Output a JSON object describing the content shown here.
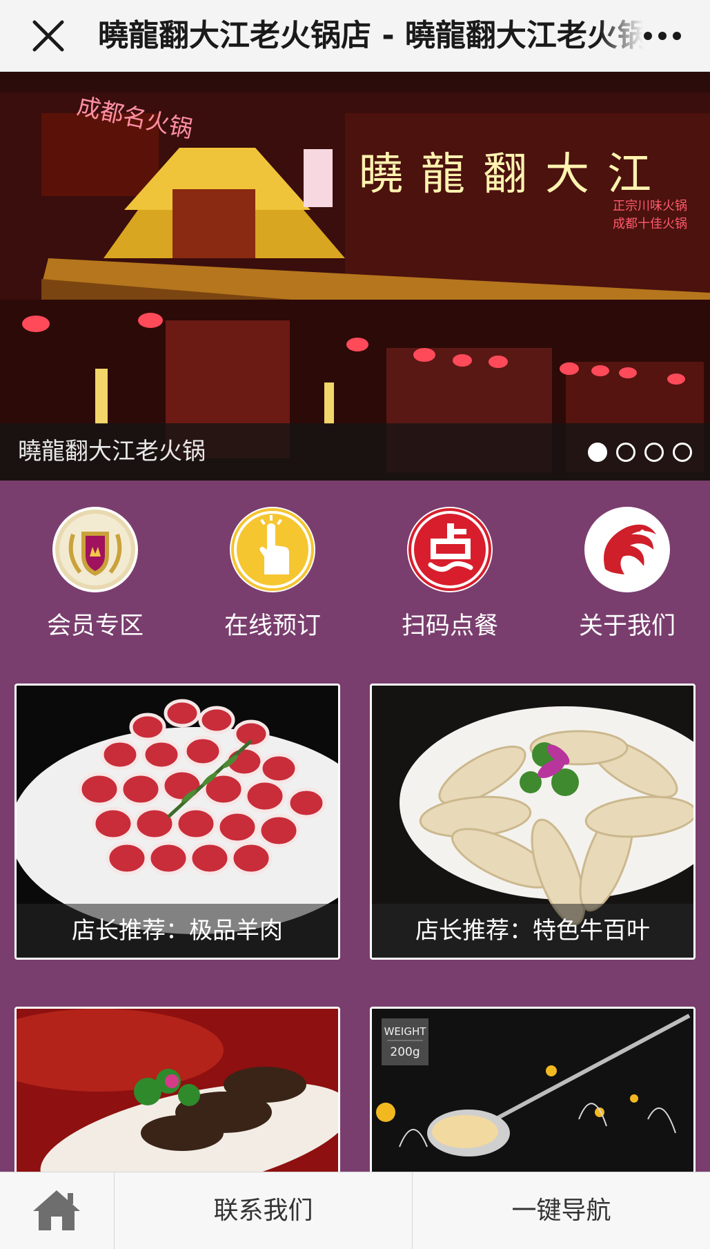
{
  "header": {
    "title": "曉龍翻大江老火锅店 - 曉龍翻大江老火锅店",
    "close_icon": "close-icon",
    "more_icon": "more-dots-icon"
  },
  "banner": {
    "caption": "曉龍翻大江老火锅",
    "slide_count": 4,
    "active_slide": 1,
    "photo_signs": {
      "left_sign": "成都名火锅",
      "main_sign": "曉龍翻大江",
      "right_sign_line1": "正宗川味火锅",
      "right_sign_line2": "成都十佳火锅"
    }
  },
  "quicknav": [
    {
      "label": "会员专区",
      "icon": "member-badge-icon"
    },
    {
      "label": "在线预订",
      "icon": "finger-tap-icon"
    },
    {
      "label": "扫码点餐",
      "icon": "order-dian-icon"
    },
    {
      "label": "关于我们",
      "icon": "dragon-logo-icon"
    }
  ],
  "cards": [
    {
      "caption": "店长推荐：极品羊肉"
    },
    {
      "caption": "店长推荐：特色牛百叶"
    },
    {
      "caption": ""
    },
    {
      "caption": "",
      "tag_line1": "WEIGHT",
      "tag_line2": "200g"
    }
  ],
  "bottombar": {
    "home_icon": "home-icon",
    "contact_label": "联系我们",
    "navigate_label": "一键导航"
  },
  "colors": {
    "background": "#7a3e6e",
    "topbar": "#f4f4f4",
    "bottombar": "#f7f7f7"
  }
}
